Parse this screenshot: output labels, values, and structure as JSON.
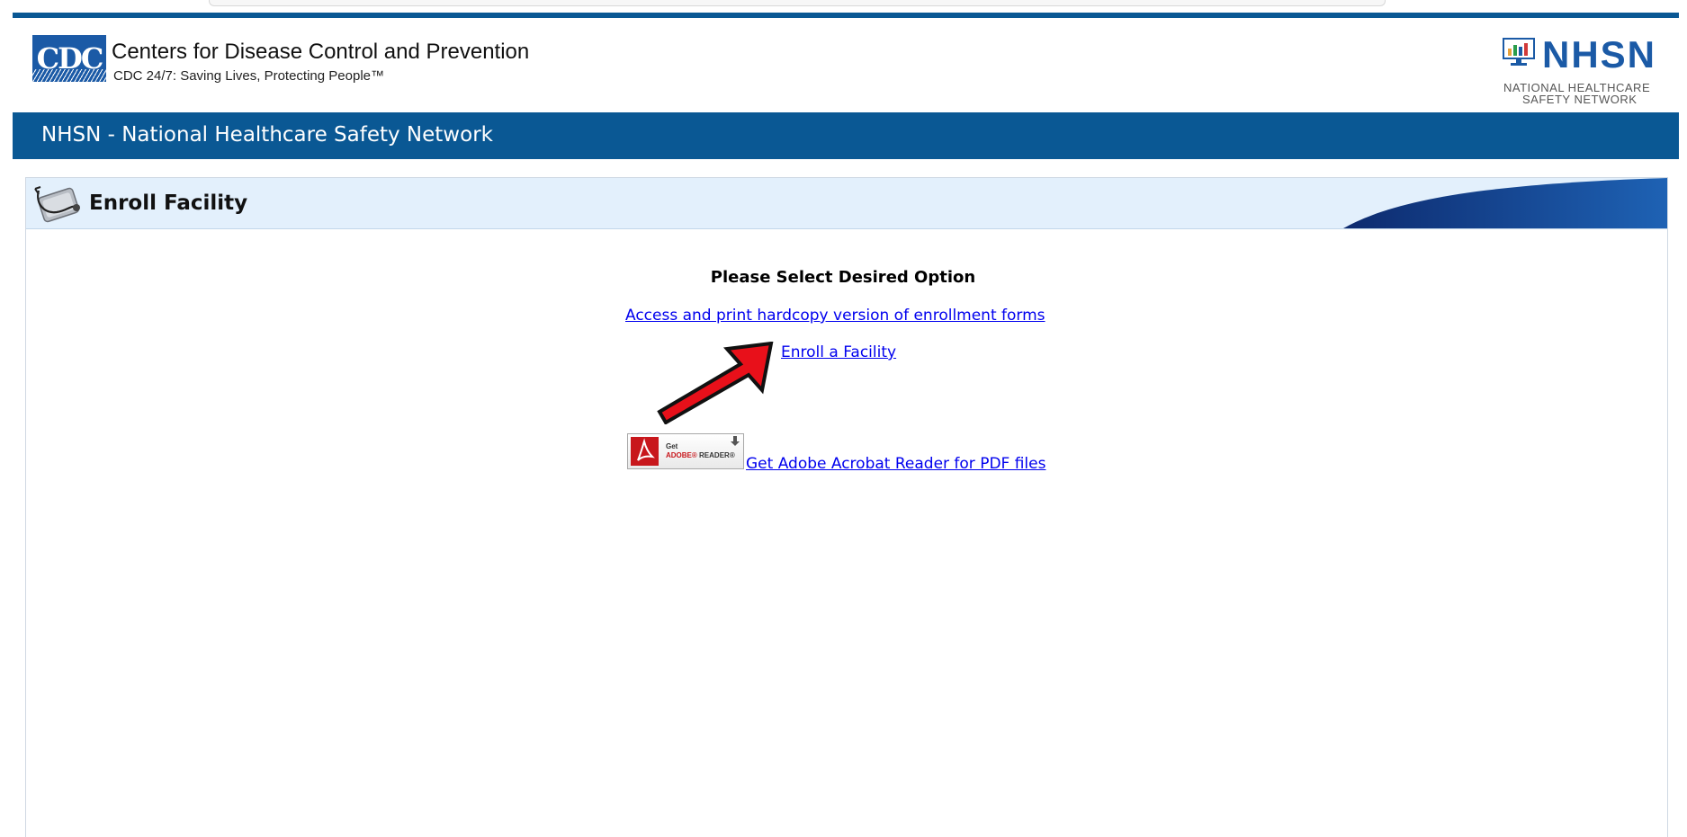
{
  "header": {
    "cdc_logo_text": "CDC",
    "cdc_title": "Centers for Disease Control and Prevention",
    "cdc_tagline": "CDC 24/7: Saving Lives, Protecting People™",
    "nhsn_logo_text": "NHSN",
    "nhsn_subtitle_line1": "NATIONAL HEALTHCARE",
    "nhsn_subtitle_line2": "SAFETY NETWORK"
  },
  "banner": {
    "title": "NHSN - National Healthcare Safety Network"
  },
  "panel": {
    "title": "Enroll Facility",
    "prompt": "Please Select Desired Option",
    "links": {
      "hardcopy": "Access and print hardcopy version of enrollment forms",
      "enroll": "Enroll a Facility",
      "adobe": "Get Adobe Acrobat Reader for PDF files"
    }
  },
  "adobe_badge": {
    "get": "Get",
    "brand": "ADOBE®",
    "product": "READER®"
  },
  "icons": {
    "panel": "stethoscope-icon",
    "nhsn": "monitor-chart-icon",
    "pointer": "red-arrow-icon",
    "pdf": "pdf-icon",
    "download": "download-icon"
  },
  "colors": {
    "brand_blue": "#0a5894",
    "panel_header": "#e3f0fc",
    "link": "#0000ee",
    "arrow_red": "#e8101a"
  }
}
